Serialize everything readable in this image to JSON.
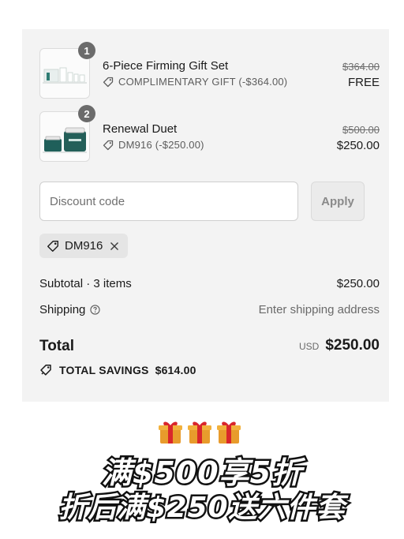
{
  "items": [
    {
      "qty": "1",
      "name": "6-Piece Firming Gift Set",
      "discount": "COMPLIMENTARY GIFT (-$364.00)",
      "original_price": "$364.00",
      "price": "FREE"
    },
    {
      "qty": "2",
      "name": "Renewal Duet",
      "discount": "DM916 (-$250.00)",
      "original_price": "$500.00",
      "price": "$250.00"
    }
  ],
  "discount": {
    "placeholder": "Discount code",
    "apply_label": "Apply",
    "applied_code": "DM916"
  },
  "summary": {
    "subtotal_label": "Subtotal · 3 items",
    "subtotal_value": "$250.00",
    "shipping_label": "Shipping",
    "shipping_value": "Enter shipping address",
    "total_label": "Total",
    "currency": "USD",
    "total_value": "$250.00",
    "savings_label": "TOTAL SAVINGS",
    "savings_value": "$614.00"
  },
  "banner": {
    "line1": "满$500享5折",
    "line2": "折后满$250送六件套"
  }
}
